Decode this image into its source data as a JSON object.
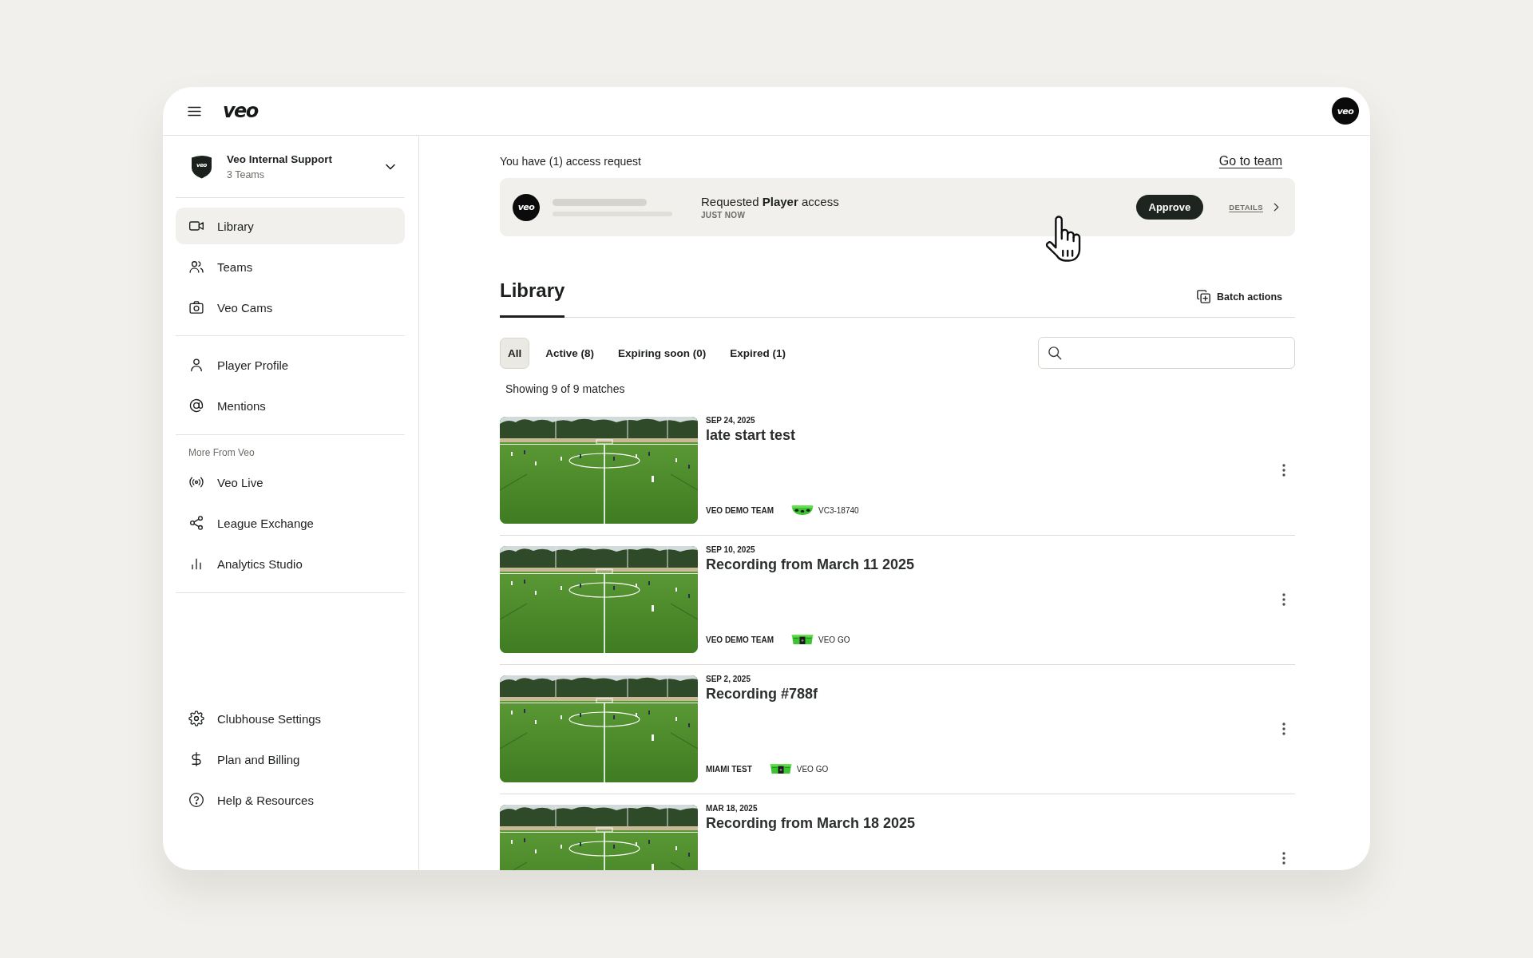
{
  "header": {
    "logo": "veo",
    "avatar": "veo"
  },
  "sidebar": {
    "team": {
      "badge": "veo",
      "name": "Veo Internal Support",
      "subtitle": "3 Teams"
    },
    "sections": [
      {
        "items": [
          {
            "label": "Library",
            "selected": true
          },
          {
            "label": "Teams",
            "selected": false
          },
          {
            "label": "Veo Cams",
            "selected": false
          }
        ]
      },
      {
        "items": [
          {
            "label": "Player Profile",
            "selected": false
          },
          {
            "label": "Mentions",
            "selected": false
          }
        ]
      },
      {
        "heading": "More From Veo",
        "items": [
          {
            "label": "Veo Live",
            "selected": false
          },
          {
            "label": "League Exchange",
            "selected": false
          },
          {
            "label": "Analytics Studio",
            "selected": false
          }
        ]
      }
    ],
    "footer_items": [
      {
        "label": "Clubhouse Settings",
        "selected": false
      },
      {
        "label": "Plan and Billing",
        "selected": false
      },
      {
        "label": "Help & Resources",
        "selected": false
      }
    ]
  },
  "access_request": {
    "summary": "You have (1) access request",
    "link": "Go to team",
    "avatar": "veo",
    "message": "Requested **Player** access",
    "time": "JUST NOW",
    "approve_button": "Approve",
    "details_link": "DETAILS"
  },
  "library": {
    "title": "Library",
    "batch_button": "Batch actions",
    "filters": [
      {
        "label": "All",
        "selected": true
      },
      {
        "label": "Active (8)",
        "selected": false
      },
      {
        "label": "Expiring soon (0)",
        "selected": false
      },
      {
        "label": "Expired (1)",
        "selected": false
      }
    ],
    "count": "Showing 9 of 9 matches",
    "matches": [
      {
        "date": "SEP 24, 2025",
        "title": "late start test",
        "team": "VEO DEMO TEAM",
        "camera": {
          "kind": "dome",
          "label": "VC3-18740"
        }
      },
      {
        "date": "SEP 10, 2025",
        "title": "Recording from March 11 2025",
        "team": "VEO DEMO TEAM",
        "camera": {
          "kind": "box",
          "label": "VEO GO"
        }
      },
      {
        "date": "SEP 2, 2025",
        "title": "Recording #788f",
        "team": "MIAMI TEST",
        "camera": {
          "kind": "box",
          "label": "VEO GO"
        }
      },
      {
        "date": "MAR 18, 2025",
        "title": "Recording from March 18 2025"
      }
    ]
  }
}
